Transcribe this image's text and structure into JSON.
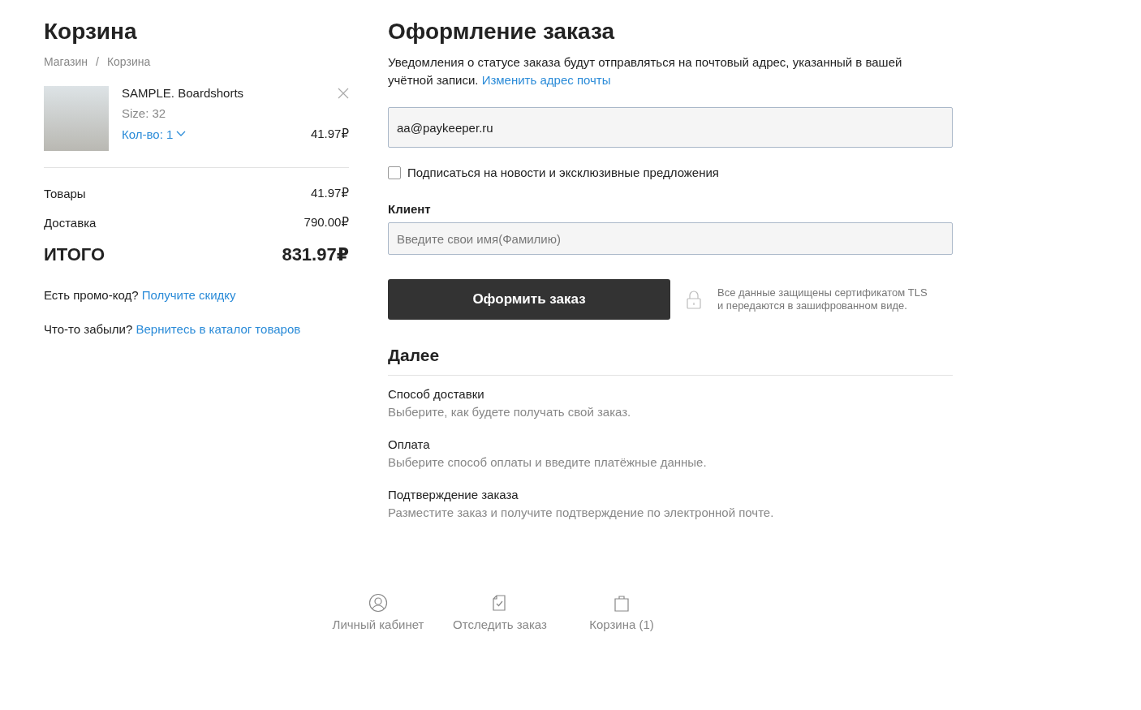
{
  "cart": {
    "title": "Корзина",
    "breadcrumbs": [
      "Магазин",
      "Корзина"
    ],
    "separator": "/",
    "items": [
      {
        "name": "SAMPLE. Boardshorts",
        "size": "Size: 32",
        "quantity": "Кол-во: 1",
        "price": "41.97₽"
      }
    ],
    "summary": [
      {
        "label": "Товары",
        "value": "41.97₽",
        "kind": "line"
      },
      {
        "label": "Доставка",
        "value": "790.00₽",
        "kind": "line"
      },
      {
        "label": "ИТОГО",
        "value": "831.97₽",
        "kind": "total"
      }
    ],
    "notes": [
      {
        "text": "Есть промо-код?",
        "link": "Получите скидку"
      },
      {
        "text": "Что-то забыли?",
        "link": "Вернитесь в каталог товаров"
      }
    ]
  },
  "checkout": {
    "title": "Оформление заказа",
    "notice": "Уведомления о статусе заказа будут отправляться на почтовый адрес, указанный в вашей учётной записи.",
    "notice_link": "Изменить адрес почты",
    "email": {
      "value": "aa@paykeeper.ru"
    },
    "subscribe": {
      "label": "Подписаться на новости и эксклюзивные предложения",
      "checked": false
    },
    "client": {
      "label": "Клиент",
      "placeholder": "Введите свои имя(Фамилию)"
    },
    "submit": "Оформить заказ",
    "security": [
      "Все данные защищены сертификатом TLS",
      "и передаются в зашифрованном виде."
    ],
    "next": {
      "title": "Далее",
      "steps": [
        {
          "title": "Способ доставки",
          "description": "Выберите, как будете получать свой заказ."
        },
        {
          "title": "Оплата",
          "description": "Выберите способ оплаты и введите платёжные данные."
        },
        {
          "title": "Подтверждение заказа",
          "description": "Разместите заказ и получите подтверждение по электронной почте."
        }
      ]
    }
  },
  "footer": [
    {
      "label": "Личный кабинет",
      "kind": "account"
    },
    {
      "label": "Отследить заказ",
      "kind": "track"
    },
    {
      "label": "Корзина (1)",
      "kind": "cart"
    }
  ]
}
